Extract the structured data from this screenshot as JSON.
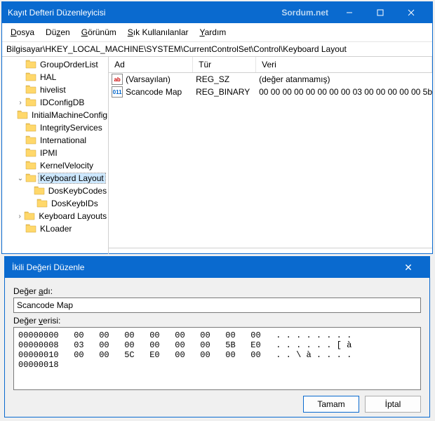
{
  "window": {
    "title": "Kayıt Defteri Düzenleyicisi",
    "watermark": "Sordum.net"
  },
  "menu": {
    "file": "Dosya",
    "edit": "Düzen",
    "view": "Görünüm",
    "favs": "Sık Kullanılanlar",
    "help": "Yardım"
  },
  "address": "Bilgisayar\\HKEY_LOCAL_MACHINE\\SYSTEM\\CurrentControlSet\\Control\\Keyboard Layout",
  "tree": {
    "items": [
      {
        "indent": 1,
        "label": "GroupOrderList"
      },
      {
        "indent": 1,
        "label": "HAL"
      },
      {
        "indent": 1,
        "label": "hivelist"
      },
      {
        "indent": 1,
        "label": "IDConfigDB",
        "expandable": true
      },
      {
        "indent": 1,
        "label": "InitialMachineConfig"
      },
      {
        "indent": 1,
        "label": "IntegrityServices"
      },
      {
        "indent": 1,
        "label": "International"
      },
      {
        "indent": 1,
        "label": "IPMI"
      },
      {
        "indent": 1,
        "label": "KernelVelocity"
      },
      {
        "indent": 1,
        "label": "Keyboard Layout",
        "expanded": true,
        "selected": true
      },
      {
        "indent": 2,
        "label": "DosKeybCodes"
      },
      {
        "indent": 2,
        "label": "DosKeybIDs"
      },
      {
        "indent": 1,
        "label": "Keyboard Layouts",
        "expandable": true
      },
      {
        "indent": 1,
        "label": "KLoader"
      }
    ]
  },
  "list": {
    "headers": {
      "name": "Ad",
      "type": "Tür",
      "data": "Veri"
    },
    "rows": [
      {
        "icon": "str",
        "name": "(Varsayılan)",
        "type": "REG_SZ",
        "data": "(değer atanmamış)"
      },
      {
        "icon": "bin",
        "name": "Scancode Map",
        "type": "REG_BINARY",
        "data": "00 00 00 00 00 00 00 00 03 00 00 00 00 00 5b"
      }
    ]
  },
  "dialog": {
    "title": "İkili Değeri Düzenle",
    "name_label": "Değer adı:",
    "name_value": "Scancode Map",
    "data_label": "Değer verisi:",
    "hex": "00000000   00   00   00   00   00   00   00   00   . . . . . . . .\n00000008   03   00   00   00   00   00   5B   E0   . . . . . . [ à\n00000010   00   00   5C   E0   00   00   00   00   . . \\ à . . . .\n00000018",
    "ok": "Tamam",
    "cancel": "İptal"
  }
}
